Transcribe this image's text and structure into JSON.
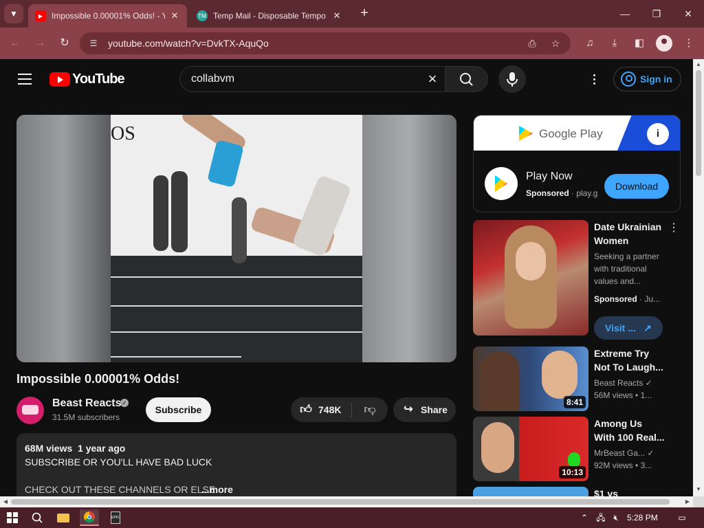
{
  "browser": {
    "tabs": [
      {
        "title": "Impossible 0.00001% Odds! - Y",
        "active": true,
        "favicon": "youtube-icon",
        "favicon_color": "#ff0000"
      },
      {
        "title": "Temp Mail - Disposable Tempo",
        "active": false,
        "favicon": "tempmail-icon",
        "favicon_color": "#26a69a"
      }
    ],
    "url": "youtube.com/watch?v=DvkTX-AquQo"
  },
  "youtube": {
    "logo_text": "YouTube",
    "search": {
      "value": "collabvm"
    },
    "signin_label": "Sign in",
    "video": {
      "title": "Impossible 0.00001% Odds!",
      "gym_text": "OS",
      "channel": "Beast Reacts",
      "subscribers": "31.5M subscribers",
      "subscribe_label": "Subscribe",
      "likes": "748K",
      "share_label": "Share",
      "views": "68M views",
      "age": "1 year ago",
      "desc_line1": "SUBSCRIBE OR YOU'LL HAVE BAD LUCK",
      "desc_line2": "CHECK OUT THESE CHANNELS OR ELSE",
      "more_label": "...more"
    },
    "ad": {
      "banner_text": "Google Play",
      "title": "Play Now",
      "sponsored": "Sponsored",
      "domain": "play.g",
      "download_label": "Download"
    },
    "recommendations": [
      {
        "title": "Date Ukrainian Women",
        "desc": "Seeking a partner with traditional values and...",
        "sponsored": "Sponsored",
        "domain": "Ju...",
        "cta": "Visit ..."
      },
      {
        "title": "Extreme Try Not To Laugh...",
        "channel": "Beast Reacts",
        "views": "56M views",
        "age": "1...",
        "duration": "8:41"
      },
      {
        "title": "Among Us With 100 Real...",
        "channel": "MrBeast Ga...",
        "views": "92M views",
        "age": "3...",
        "duration": "10:13"
      },
      {
        "title": "$1 vs"
      }
    ]
  },
  "taskbar": {
    "clock": "5:28 PM"
  },
  "colors": {
    "chrome_frame": "#5b2a30",
    "chrome_toolbar": "#8a4149",
    "youtube_red": "#ff0000",
    "link_blue": "#3ea6ff",
    "taskbar": "#4a1f28"
  }
}
